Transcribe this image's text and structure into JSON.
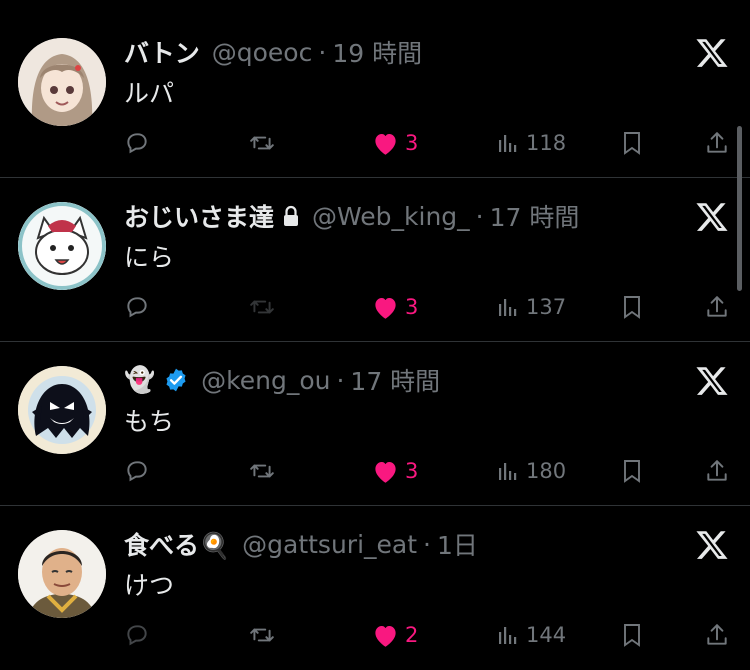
{
  "tweets": [
    {
      "name": "バトン",
      "handle": "@qoeoc",
      "separator": "·",
      "time": "19 時間",
      "text": "ルパ",
      "locked": false,
      "verified": false,
      "avatar": "avatar-girl",
      "likes": "3",
      "views": "118",
      "retweet_dimmed": false
    },
    {
      "name": "おじいさま達",
      "handle": "@Web_king_",
      "separator": "·",
      "time": "17 時間",
      "text": "にら",
      "locked": true,
      "verified": false,
      "avatar": "avatar-cat",
      "likes": "3",
      "views": "137",
      "retweet_dimmed": true
    },
    {
      "name": "👻",
      "handle": "@keng_ou",
      "separator": "·",
      "time": "17 時間",
      "text": "もち",
      "locked": false,
      "verified": true,
      "avatar": "avatar-ghost",
      "likes": "3",
      "views": "180",
      "retweet_dimmed": false
    },
    {
      "name": "食べる🍳",
      "handle": "@gattsuri_eat",
      "separator": "·",
      "time": "1日",
      "text": "けつ",
      "locked": false,
      "verified": false,
      "avatar": "avatar-man",
      "likes": "2",
      "views": "144",
      "retweet_dimmed": false
    }
  ],
  "colors": {
    "background": "#000000",
    "text": "#e7e9ea",
    "muted": "#71767b",
    "like": "#f91880",
    "verified": "#1d9bf0",
    "divider": "#2f3336"
  },
  "icons": {
    "reply": "speech-bubble-icon",
    "retweet": "retweet-icon",
    "like": "heart-filled-icon",
    "views": "bar-chart-icon",
    "bookmark": "bookmark-icon",
    "share": "share-upload-icon",
    "brand": "x-logo-icon",
    "lock": "lock-icon",
    "verified": "verified-badge-icon"
  }
}
